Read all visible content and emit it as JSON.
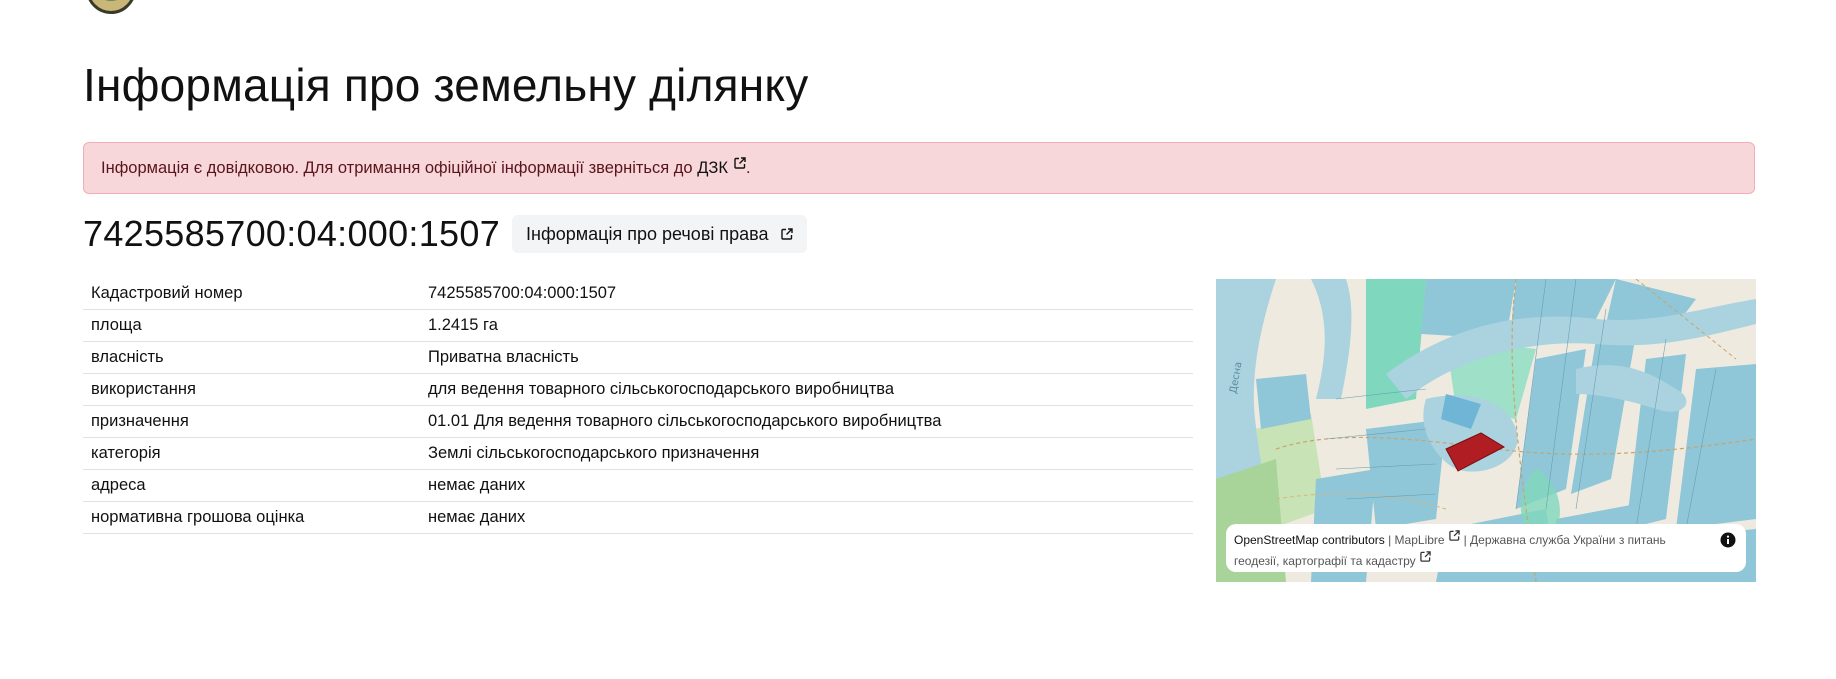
{
  "page": {
    "title": "Інформація про земельну ділянку"
  },
  "alert": {
    "text": "Інформація є довідковою. Для отримання офіційної інформації зверніться до ",
    "link_text": "ДЗК",
    "suffix": "."
  },
  "parcel": {
    "cadastral_number": "7425585700:04:000:1507",
    "rights_button_label": "Інформація про речові права"
  },
  "details": [
    {
      "key": "Кадастровий номер",
      "value": "7425585700:04:000:1507"
    },
    {
      "key": "площа",
      "value": "1.2415 га"
    },
    {
      "key": "власність",
      "value": "Приватна власність"
    },
    {
      "key": "використання",
      "value": "для ведення товарного сільськогосподарського виробництва"
    },
    {
      "key": "призначення",
      "value": "01.01 Для ведення товарного сільськогосподарського виробництва"
    },
    {
      "key": "категорія",
      "value": "Землі сільськогосподарського призначення"
    },
    {
      "key": "адреса",
      "value": "немає даних"
    },
    {
      "key": "нормативна грошова оцінка",
      "value": "немає даних"
    }
  ],
  "map": {
    "river_label": "Десна",
    "attribution": {
      "osm": "OpenStreetMap contributors",
      "separator": " | ",
      "maplibre": "MapLibre",
      "agency": "Державна служба України з питань геодезії, картографії та кадастру"
    },
    "colors": {
      "water": "#aad3df",
      "parcel_blue": "#8fc6d8",
      "parcel_green": "#7fd8bd",
      "selected_parcel": "#b01e23"
    }
  },
  "icons": {
    "external_link": "external-link-icon",
    "info": "info-icon",
    "logo": "emblem-logo"
  }
}
